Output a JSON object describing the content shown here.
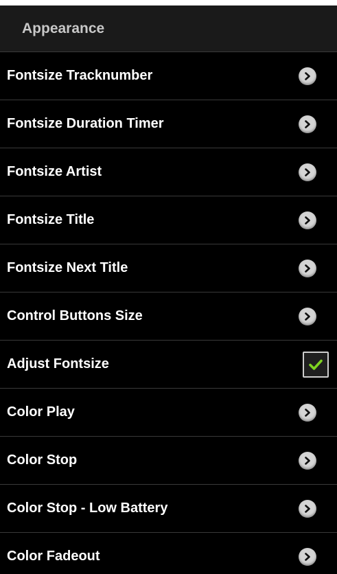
{
  "header": {
    "title": "Appearance"
  },
  "items": [
    {
      "label": "Fontsize Tracknumber",
      "type": "navigation",
      "icon": "chevron-right-icon"
    },
    {
      "label": "Fontsize Duration Timer",
      "type": "navigation",
      "icon": "chevron-right-icon"
    },
    {
      "label": "Fontsize Artist",
      "type": "navigation",
      "icon": "chevron-right-icon"
    },
    {
      "label": "Fontsize Title",
      "type": "navigation",
      "icon": "chevron-right-icon"
    },
    {
      "label": "Fontsize Next Title",
      "type": "navigation",
      "icon": "chevron-right-icon"
    },
    {
      "label": "Control Buttons Size",
      "type": "navigation",
      "icon": "chevron-right-icon"
    },
    {
      "label": "Adjust Fontsize",
      "type": "checkbox",
      "checked": true,
      "icon": "checkmark-icon"
    },
    {
      "label": "Color Play",
      "type": "navigation",
      "icon": "chevron-right-icon"
    },
    {
      "label": "Color Stop",
      "type": "navigation",
      "icon": "chevron-right-icon"
    },
    {
      "label": "Color Stop - Low Battery",
      "type": "navigation",
      "icon": "chevron-right-icon"
    },
    {
      "label": "Color Fadeout",
      "type": "navigation",
      "icon": "chevron-right-icon"
    }
  ],
  "colors": {
    "background": "#000000",
    "header_background": "#1a1a1a",
    "header_text": "#c8c8c8",
    "item_text": "#ffffff",
    "divider": "#3a3a3a",
    "checkmark": "#7ed321"
  }
}
